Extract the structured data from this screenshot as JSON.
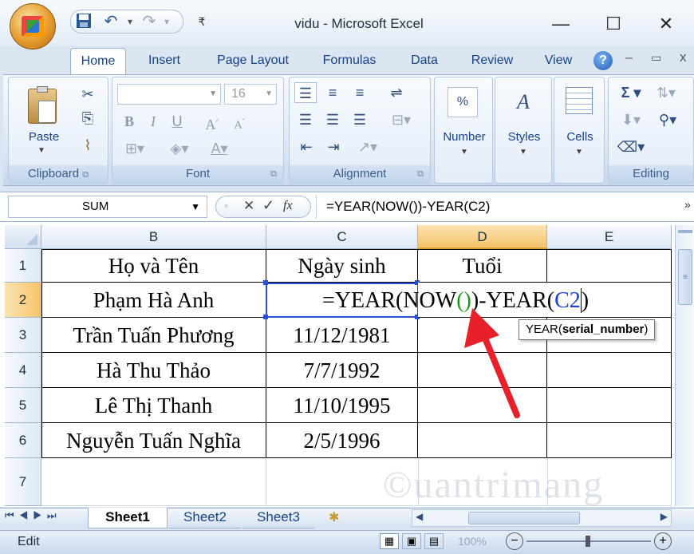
{
  "window": {
    "title": "vidu - Microsoft Excel",
    "minimize": "—",
    "maximize": "☐",
    "close": "✕"
  },
  "tabs": [
    "Home",
    "Insert",
    "Page Layout",
    "Formulas",
    "Data",
    "Review",
    "View"
  ],
  "ribbon": {
    "clipboard": {
      "label": "Clipboard",
      "paste": "Paste"
    },
    "font": {
      "label": "Font",
      "size": "16"
    },
    "alignment": {
      "label": "Alignment"
    },
    "number": {
      "label": "Number",
      "icon_text": "%"
    },
    "styles": {
      "label": "Styles"
    },
    "cells": {
      "label": "Cells"
    },
    "editing": {
      "label": "Editing"
    }
  },
  "formula_bar": {
    "name_box": "SUM",
    "formula": "=YEAR(NOW())-YEAR(C2)"
  },
  "columns": [
    "B",
    "C",
    "D",
    "E"
  ],
  "rows": [
    "1",
    "2",
    "3",
    "4",
    "5",
    "6",
    "7"
  ],
  "cells": {
    "B1": "Họ và Tên",
    "C1": "Ngày sinh",
    "D1": "Tuổi",
    "B2": "Phạm Hà Anh",
    "B3": "Trần Tuấn Phương",
    "C3": "11/12/1981",
    "B4": "Hà Thu Thảo",
    "C4": "7/7/1992",
    "B5": "Lê Thị Thanh",
    "C5": "11/10/1995",
    "B6": "Nguyễn Tuấn Nghĩa",
    "C6": "2/5/1996"
  },
  "edit_formula": {
    "p1": "=YEAR(NOW",
    "p2": "()",
    "p3": ")-YEAR(",
    "p4": "C2",
    "p5": ")"
  },
  "tooltip": {
    "func": "YEAR(",
    "arg": "serial_number",
    "close": ")"
  },
  "sheets": [
    "Sheet1",
    "Sheet2",
    "Sheet3"
  ],
  "status": {
    "mode": "Edit",
    "zoom": "100%"
  },
  "colors": {
    "accent": "#15428b",
    "arrow": "#e8202a",
    "ref_blue": "#1a3fe0",
    "paren_green": "#1a9a1a"
  }
}
